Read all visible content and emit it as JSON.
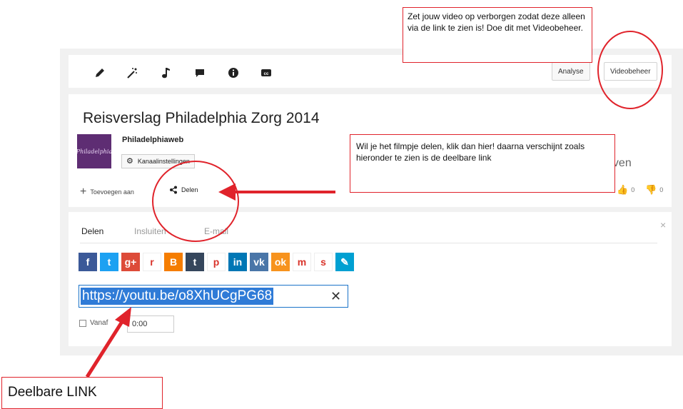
{
  "toolbar": {
    "icons": [
      "pencil-icon",
      "magic-wand-icon",
      "music-note-icon",
      "comment-icon",
      "info-icon",
      "cc-icon"
    ],
    "analyse_label": "Analyse",
    "videobeheer_label": "Videobeheer"
  },
  "video": {
    "title": "Reisverslag Philadelphia Zorg 2014",
    "channel_name": "Philadelphiaweb",
    "channel_logo_text": "Philadelphia",
    "channel_settings_label": "Kanaalinstellingen",
    "views_label": "eergaven",
    "add_to_label": "Toevoegen aan",
    "share_label": "Delen",
    "likes": "0",
    "dislikes": "0"
  },
  "share": {
    "tabs": [
      "Delen",
      "Insluiten",
      "E-mail"
    ],
    "close_glyph": "×",
    "social": [
      {
        "name": "facebook",
        "glyph": "f",
        "color": "#3b5998"
      },
      {
        "name": "twitter",
        "glyph": "t",
        "color": "#1da1f2"
      },
      {
        "name": "google-plus",
        "glyph": "g+",
        "color": "#dd4b39"
      },
      {
        "name": "reddit",
        "glyph": "r",
        "color": "#ffffff"
      },
      {
        "name": "blogger",
        "glyph": "B",
        "color": "#f57d00"
      },
      {
        "name": "tumblr",
        "glyph": "t",
        "color": "#35465c"
      },
      {
        "name": "pinterest",
        "glyph": "p",
        "color": "#ffffff"
      },
      {
        "name": "linkedin",
        "glyph": "in",
        "color": "#0077b5"
      },
      {
        "name": "vk",
        "glyph": "vk",
        "color": "#4a76a8"
      },
      {
        "name": "odnoklassniki",
        "glyph": "ok",
        "color": "#f7931e"
      },
      {
        "name": "mixi",
        "glyph": "m",
        "color": "#ffffff"
      },
      {
        "name": "stumbleupon",
        "glyph": "s",
        "color": "#ffffff"
      },
      {
        "name": "livejournal",
        "glyph": "✎",
        "color": "#00a0d2"
      }
    ],
    "url": "https://youtu.be/o8XhUCgPG68",
    "clear_glyph": "✕",
    "start_at_label": "Vanaf",
    "start_time": "0:00"
  },
  "annotations": {
    "hide_video": "Zet jouw video op verborgen zodat deze alleen via de link te zien is! Doe dit met Videobeheer.",
    "share_hint": "Wil je het filmpje delen, klik dan hier! daarna verschijnt zoals hieronder te zien is de deelbare link",
    "shareable_link": "Deelbare LINK",
    "color": "#e0232b"
  }
}
